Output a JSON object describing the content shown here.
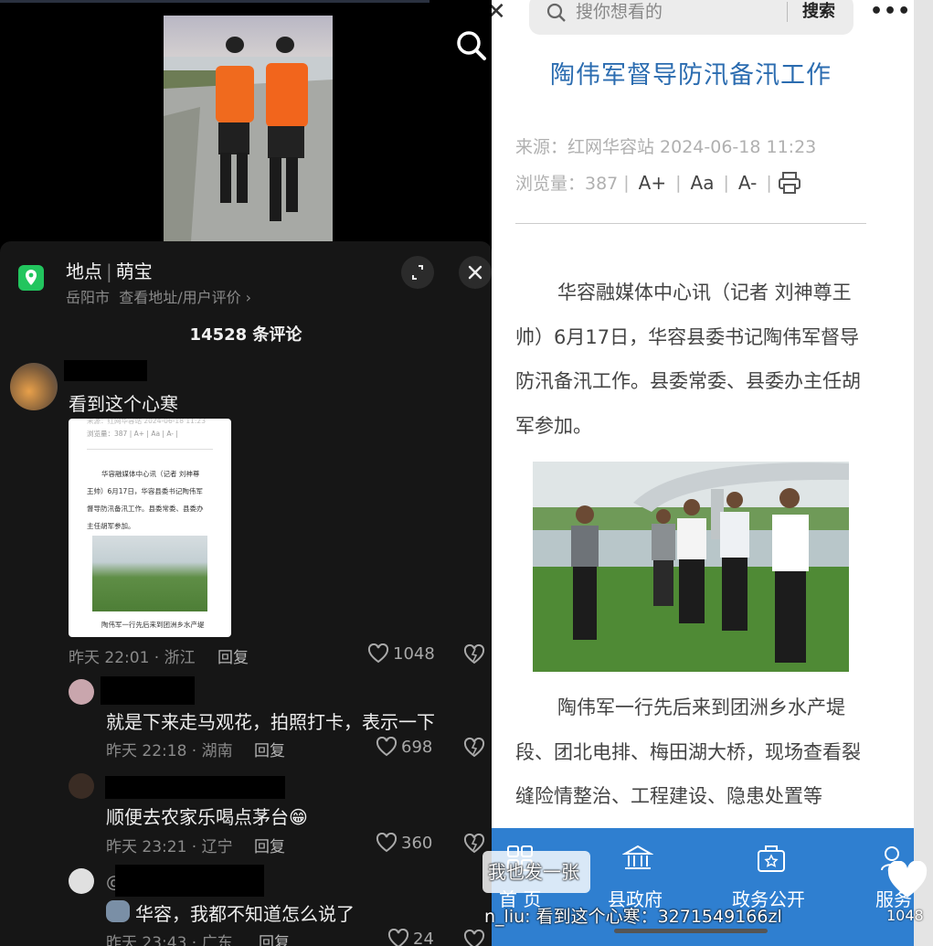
{
  "left": {
    "location": {
      "label": "地点",
      "name": "萌宝",
      "city": "岳阳市",
      "link": "查看地址/用户评价 ›"
    },
    "comment_count": "14528 条评论",
    "comments": [
      {
        "text": "看到这个心寒",
        "time": "昨天 22:01 · 浙江",
        "reply": "回复",
        "likes": "1048"
      },
      {
        "text": "就是下来走马观花，拍照打卡，表示一下",
        "time": "昨天 22:18 · 湖南",
        "reply": "回复",
        "likes": "698"
      },
      {
        "text": "顺便去农家乐喝点茅台😁",
        "time": "昨天 23:21 · 辽宁",
        "reply": "回复",
        "likes": "360"
      },
      {
        "prefix": "@",
        "text": "华容，我都不知道怎么说了",
        "time": "昨天 23:43 · 广东",
        "reply": "回复",
        "likes": "24"
      }
    ],
    "shot": {
      "l1": "来源：红网华容站  2024-06-18 11:23",
      "l2": "浏览量：387 | A+ | Aa | A- | ",
      "p1": "华容融媒体中心讯（记者 刘神尊",
      "p2": "王帅）6月17日，华容县委书记陶伟军",
      "p3": "督导防汛备汛工作。县委常委、县委办",
      "p4": "主任胡军参加。",
      "p5": "陶伟军一行先后来到团洲乡水产堤"
    }
  },
  "right": {
    "search_placeholder": "搜你想看的",
    "search_button": "搜索",
    "more": "•••",
    "close": "✕",
    "headline": "陶伟军督导防汛备汛工作",
    "source": "来源：红网华容站   2024-06-18 11:23",
    "views_label": "浏览量：387",
    "font_big": "A+",
    "font_mid": "Aa",
    "font_small": "A-",
    "para1": "华容融媒体中心讯（记者 刘神尊王帅）6月17日，华容县委书记陶伟军督导防汛备汛工作。县委常委、县委办主任胡军参加。",
    "para2": "陶伟军一行先后来到团洲乡水产堤段、团北电排、梅田湖大桥，现场查看裂缝险情整治、工程建设、隐患处置等",
    "nav": [
      {
        "label": "首 页"
      },
      {
        "label": "县政府"
      },
      {
        "label": "政务公开"
      },
      {
        "label": "服务"
      }
    ]
  },
  "overlay": {
    "danmu1": "我也发一张",
    "danmu2": "n_liu: 看到这个心寒：3271549166zl",
    "heart_count": "1048"
  }
}
